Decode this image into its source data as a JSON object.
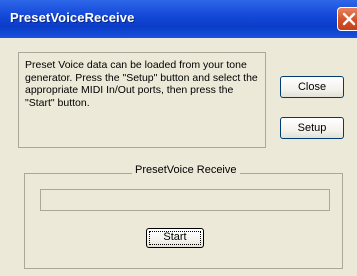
{
  "window": {
    "title": "PresetVoiceReceive"
  },
  "info": {
    "message": "Preset Voice data can be loaded from your tone generator. Press the \"Setup\" button and select the appropriate MIDI In/Out ports, then press the \"Start\" button."
  },
  "buttons": {
    "close_label": "Close",
    "setup_label": "Setup",
    "start_label": "Start"
  },
  "receive": {
    "group_label": "PresetVoice Receive",
    "progress_fraction": 0
  },
  "colors": {
    "titlebar": "#0a3cc8",
    "window_bg": "#ece9d8",
    "close_button": "#d3502a"
  },
  "icons": {
    "close": "close-icon"
  }
}
